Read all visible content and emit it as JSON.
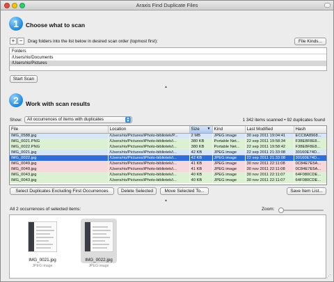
{
  "window": {
    "title": "Araxis Find Duplicate Files"
  },
  "section1": {
    "number": "1",
    "title": "Choose what to scan",
    "add_label": "+",
    "remove_label": "−",
    "instruction": "Drag folders into the list below in desired scan order (topmost first):",
    "file_kinds_label": "File Kinds...",
    "folders_header": "Folders",
    "folders": [
      "/Users/rio/Documents",
      "/Users/rio/Pictures"
    ],
    "start_scan_label": "Start Scan"
  },
  "section2": {
    "number": "2",
    "title": "Work with scan results",
    "show_label": "Show:",
    "show_value": "All occurrences of items with duplicates",
    "summary": "1 342 items scanned • 92 duplicates found",
    "columns": [
      "File",
      "Location",
      "Size",
      "Kind",
      "Last Modified",
      "Hash"
    ],
    "sort_indicator": "▼",
    "rows": [
      {
        "file": "IMG_0588.jpg",
        "location": "/Users/rio/Pictures/iPhoto-bibliotek/P...",
        "size": "2 MB",
        "kind": "JPEG image",
        "modified": "30 sep 2011 19:04:41",
        "hash": "ECC8A8968...",
        "group": "blue",
        "selected": false
      },
      {
        "file": "IMG_0021.PNG",
        "location": "/Users/rio/Pictures/iPhoto-bibliotek/i...",
        "size": "380 KB",
        "kind": "Portable Net...",
        "modified": "22 sep 2011 19:58:34",
        "hash": "F38E8F8E8...",
        "group": "green",
        "selected": false
      },
      {
        "file": "IMG_0022.PNG",
        "location": "/Users/rio/Pictures/iPhoto-bibliotek/i...",
        "size": "380 KB",
        "kind": "Portable Net...",
        "modified": "22 sep 2011 19:58:42",
        "hash": "F38E8F8E8...",
        "group": "green",
        "selected": false
      },
      {
        "file": "IMG_0021.jpg",
        "location": "/Users/rio/Pictures/iPhoto-bibliotek/i...",
        "size": "42 KB",
        "kind": "JPEG image",
        "modified": "22 sep 2011 21:33:08",
        "hash": "30160E74D...",
        "group": "blue",
        "selected": false
      },
      {
        "file": "IMG_0022.jpg",
        "location": "/Users/rio/Pictures/iPhoto-bibliotek/i...",
        "size": "42 KB",
        "kind": "JPEG image",
        "modified": "22 sep 2011 21:33:08",
        "hash": "30160E74D...",
        "group": "blue",
        "selected": true
      },
      {
        "file": "IMG_0049.jpg",
        "location": "/Users/rio/Pictures/iPhoto-bibliotek/i...",
        "size": "41 KB",
        "kind": "JPEG image",
        "modified": "30 nov 2011 22:11:08",
        "hash": "0C84E7E5A...",
        "group": "pink",
        "selected": false
      },
      {
        "file": "IMG_0049.jpg",
        "location": "/Users/rio/Pictures/iPhoto-bibliotek/i...",
        "size": "41 KB",
        "kind": "JPEG image",
        "modified": "30 nov 2011 22:11:08",
        "hash": "0C84E7E5A...",
        "group": "pink",
        "selected": false
      },
      {
        "file": "IMG_0043.jpg",
        "location": "/Users/rio/Pictures/iPhoto-bibliotek/i...",
        "size": "40 KB",
        "kind": "JPEG image",
        "modified": "30 nov 2011 22:11:07",
        "hash": "64F080CDE...",
        "group": "green",
        "selected": false
      },
      {
        "file": "IMG_0043.jpg",
        "location": "/Users/rio/Pictures/iPhoto-bibliotek/i...",
        "size": "40 KB",
        "kind": "JPEG image",
        "modified": "30 nov 2011 22:11:07",
        "hash": "64F080CDE...",
        "group": "green",
        "selected": false
      }
    ],
    "select_dupes_label": "Select Duplicates Excluding First Occurrences",
    "delete_selected_label": "Delete Selected",
    "move_selected_label": "Move Selected To...",
    "save_list_label": "Save Item List..."
  },
  "preview": {
    "heading": "All 2 occurrences of selected items:",
    "zoom_label": "Zoom:",
    "zoom_level": 0.05,
    "items": [
      {
        "name": "IMG_0021.jpg",
        "kind": "JPEG image",
        "selected": false
      },
      {
        "name": "IMG_0022.jpg",
        "kind": "JPEG image",
        "selected": true
      }
    ]
  },
  "colors": {
    "accent": "#1e88d8",
    "selection": "#2f6fd3",
    "group_blue": "#d8e6f5",
    "group_green": "#dcf1d4",
    "group_pink": "#f6d8dc"
  }
}
